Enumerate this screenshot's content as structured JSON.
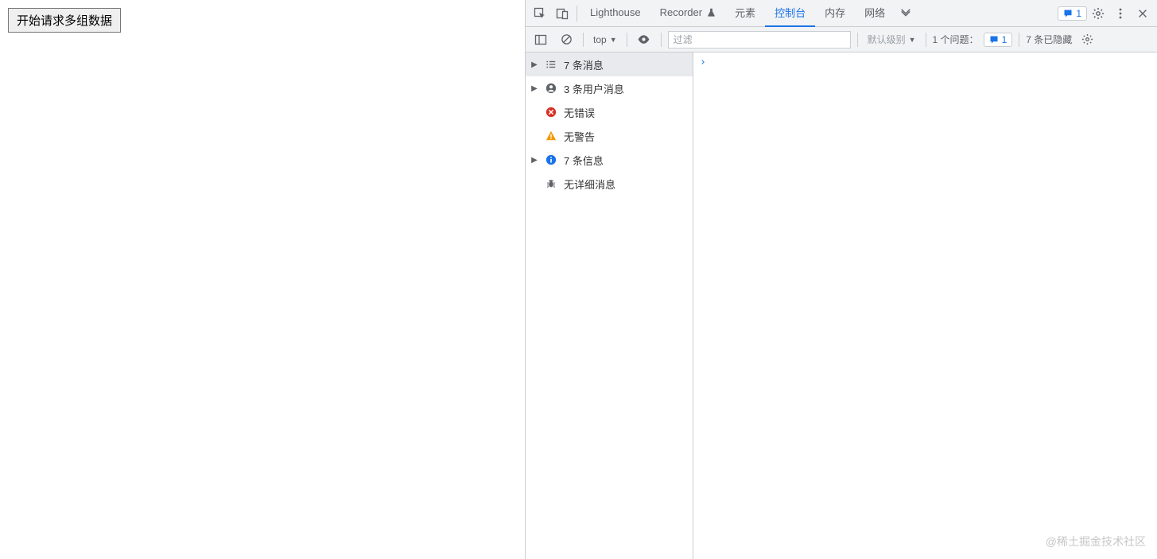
{
  "page": {
    "button_label": "开始请求多组数据"
  },
  "devtools": {
    "tabs": {
      "lighthouse": "Lighthouse",
      "recorder": "Recorder",
      "elements": "元素",
      "console": "控制台",
      "memory": "内存",
      "network": "网络"
    },
    "tab_badge_count": "1",
    "toolbar": {
      "context": "top",
      "filter_placeholder": "过滤",
      "level_label": "默认级别",
      "issues_label": "1 个问题：",
      "issues_count": "1",
      "hidden_label": "7 条已隐藏"
    },
    "sidebar": {
      "items": [
        {
          "label": "7 条消息",
          "icon": "list",
          "expandable": true,
          "selected": true
        },
        {
          "label": "3 条用户消息",
          "icon": "user",
          "expandable": true,
          "selected": false
        },
        {
          "label": "无错误",
          "icon": "error",
          "expandable": false,
          "selected": false
        },
        {
          "label": "无警告",
          "icon": "warning",
          "expandable": false,
          "selected": false
        },
        {
          "label": "7 条信息",
          "icon": "info",
          "expandable": true,
          "selected": false
        },
        {
          "label": "无详细消息",
          "icon": "bug",
          "expandable": false,
          "selected": false
        }
      ]
    }
  },
  "watermark": "@稀土掘金技术社区"
}
